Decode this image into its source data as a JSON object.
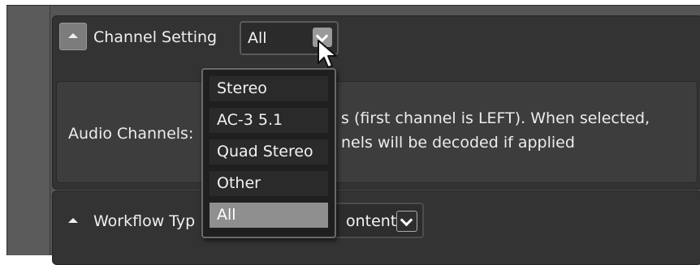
{
  "channel_setting": {
    "title": "Channel Setting",
    "selected": "All",
    "options": [
      "Stereo",
      "AC-3 5.1",
      "Quad Stereo",
      "Other",
      "All"
    ]
  },
  "audio": {
    "label": "Audio Channels:",
    "description_line1": "s (first channel is LEFT). When selected,",
    "description_line2": "nels will be decoded if applied"
  },
  "workflow": {
    "title": "Workflow Typ",
    "combo_value": "ontent"
  }
}
